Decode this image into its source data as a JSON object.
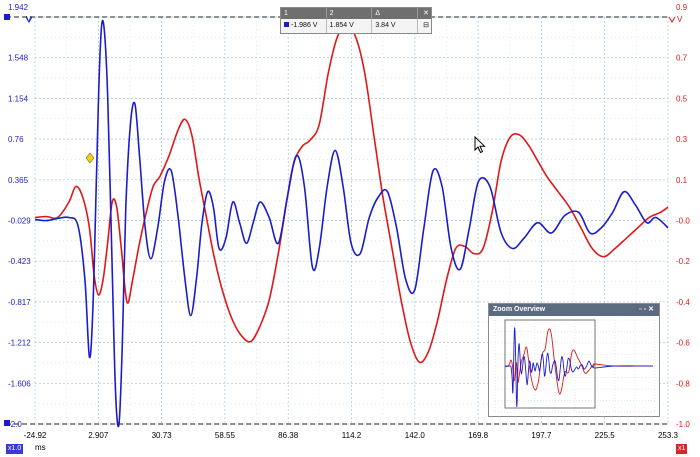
{
  "chart_data": {
    "type": "line",
    "x_ticks": [
      "-24.92",
      "2.907",
      "30.73",
      "58.55",
      "86.38",
      "114.2",
      "142.0",
      "169.8",
      "197.7",
      "225.5",
      "253.3"
    ],
    "xlim": [
      -24.92,
      253.3
    ],
    "x_unit": "ms",
    "y_left_ticks": [
      "1.942",
      "1.548",
      "1.154",
      "0.76",
      "0.365",
      "-0.029",
      "-0.423",
      "-0.817",
      "-1.212",
      "-1.606",
      "-2.0"
    ],
    "y_left_unit": "V",
    "ylim_left": [
      -2.0,
      1.942
    ],
    "y_right_ticks": [
      "0.9",
      "0.7",
      "0.5",
      "0.3",
      "0.1",
      "-0.0",
      "-0.2",
      "-0.4",
      "-0.6",
      "-0.8",
      "-1.0"
    ],
    "y_right_unit": "V",
    "grid": true,
    "series": [
      {
        "color": "#1c1ccc",
        "x": [
          -24.9,
          -20.0,
          -15.0,
          -10.0,
          -6.0,
          -3.0,
          -1.0,
          0.5,
          2.0,
          3.5,
          5.0,
          7.0,
          9.0,
          10.5,
          12.0,
          13.5,
          15.0,
          17.0,
          19.0,
          21.0,
          23.5,
          26.0,
          29.0,
          32.0,
          35.0,
          38.0,
          41.0,
          43.5,
          46.0,
          48.5,
          51.0,
          53.5,
          56.0,
          59.0,
          62.0,
          65.0,
          68.0,
          71.0,
          74.0,
          78.0,
          82.0,
          86.0,
          90.0,
          93.5,
          97.0,
          100.0,
          103.5,
          107.0,
          110.5,
          114.0,
          118.0,
          122.0,
          126.0,
          130.0,
          134.0,
          138.0,
          142.0,
          146.0,
          150.0,
          154.0,
          158.0,
          162.0,
          166.0,
          170.0,
          175.0,
          180.0,
          185.0,
          190.0,
          196.0,
          202.0,
          208.0,
          214.0,
          219.0,
          224.0,
          229.0,
          234.0,
          239.0,
          244.0,
          248.0,
          253.3
        ],
        "values": [
          -0.02,
          -0.03,
          -0.01,
          0.0,
          -0.08,
          -0.6,
          -1.35,
          -0.9,
          0.3,
          1.5,
          1.9,
          1.2,
          -0.5,
          -1.7,
          -2.0,
          -1.2,
          0.1,
          0.9,
          1.1,
          0.6,
          -0.1,
          -0.4,
          -0.1,
          0.35,
          0.45,
          0.0,
          -0.6,
          -0.95,
          -0.6,
          -0.05,
          0.25,
          0.1,
          -0.3,
          -0.2,
          0.15,
          -0.05,
          -0.25,
          -0.05,
          0.15,
          0.0,
          -0.25,
          0.2,
          0.6,
          0.3,
          -0.48,
          -0.3,
          0.3,
          0.65,
          0.3,
          -0.25,
          -0.35,
          0.0,
          0.2,
          0.25,
          -0.1,
          -0.6,
          -0.7,
          -0.1,
          0.45,
          0.3,
          -0.3,
          -0.5,
          -0.1,
          0.35,
          0.3,
          -0.15,
          -0.3,
          -0.2,
          -0.05,
          -0.15,
          0.02,
          0.05,
          -0.15,
          -0.1,
          0.05,
          0.25,
          0.12,
          -0.05,
          0.0,
          -0.1
        ]
      },
      {
        "color": "#e01818",
        "x": [
          -24.9,
          -20.0,
          -15.0,
          -10.0,
          -7.0,
          -4.0,
          -1.0,
          1.0,
          3.0,
          5.0,
          7.0,
          9.0,
          11.0,
          13.0,
          15.5,
          18.0,
          21.0,
          24.0,
          27.0,
          30.0,
          34.0,
          38.0,
          41.0,
          44.0,
          47.0,
          50.0,
          54.0,
          58.0,
          62.0,
          66.0,
          70.0,
          74.0,
          78.0,
          82.0,
          86.0,
          88.0,
          90.0,
          93.0,
          96.0,
          100.0,
          104.0,
          108.0,
          112.0,
          116.0,
          120.0,
          124.0,
          128.0,
          132.0,
          136.0,
          140.0,
          144.0,
          148.0,
          152.0,
          156.0,
          160.0,
          164.0,
          168.0,
          172.0,
          176.0,
          180.0,
          184.0,
          188.0,
          192.0,
          196.0,
          200.0,
          205.0,
          210.0,
          215.0,
          220.0,
          225.0,
          230.0,
          235.0,
          240.0,
          245.0,
          250.0,
          253.3
        ],
        "values": [
          0.0,
          0.01,
          0.0,
          0.15,
          0.3,
          0.2,
          -0.1,
          -0.55,
          -0.75,
          -0.6,
          -0.25,
          0.15,
          0.1,
          -0.3,
          -0.82,
          -0.6,
          -0.25,
          0.05,
          0.3,
          0.4,
          0.6,
          0.85,
          0.95,
          0.8,
          0.4,
          0.05,
          -0.4,
          -0.75,
          -1.0,
          -1.15,
          -1.2,
          -1.05,
          -0.8,
          -0.35,
          0.2,
          0.45,
          0.6,
          0.7,
          0.75,
          0.9,
          1.4,
          1.75,
          1.85,
          1.75,
          1.4,
          0.8,
          0.2,
          -0.3,
          -0.8,
          -1.2,
          -1.4,
          -1.3,
          -1.0,
          -0.6,
          -0.3,
          -0.28,
          -0.35,
          -0.3,
          0.05,
          0.55,
          0.78,
          0.8,
          0.7,
          0.55,
          0.4,
          0.25,
          0.1,
          -0.1,
          -0.3,
          -0.38,
          -0.3,
          -0.2,
          -0.1,
          0.0,
          0.05,
          0.1
        ]
      }
    ]
  },
  "ruler_panel": {
    "col_labels": [
      "1",
      "2",
      "Δ"
    ],
    "values": [
      "-1.986 V",
      "1.854 V",
      "3.84 V"
    ]
  },
  "zoom_overview": {
    "title": "Zoom Overview"
  },
  "scale_badges": [
    "x1.0",
    "x1"
  ]
}
